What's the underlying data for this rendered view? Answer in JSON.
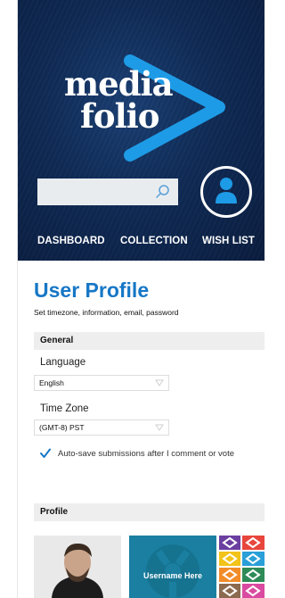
{
  "brand": {
    "line1": "media",
    "line2": "folio"
  },
  "search": {
    "placeholder": "",
    "value": ""
  },
  "nav": {
    "dashboard": "DASHBOARD",
    "collection": "COLLECTION",
    "wishlist": "WISH LIST"
  },
  "page": {
    "title": "User Profile",
    "subtitle": "Set timezone, information, email, password"
  },
  "general": {
    "heading": "General",
    "language_label": "Language",
    "language_value": "English",
    "timezone_label": "Time Zone",
    "timezone_value": "(GMT-8) PST",
    "autosave_label": "Auto-save submissions after I comment or vote",
    "autosave_checked": true
  },
  "profile": {
    "heading": "Profile",
    "username_placeholder": "Username Here"
  },
  "colors": {
    "header_bg": "#0f2a55",
    "accent": "#1677c6",
    "logo_blue": "#1e9be6",
    "card_teal": "#1a7fa0",
    "section_bg": "#eeeeee"
  },
  "icons": {
    "search": "search-icon",
    "user": "user-icon",
    "chevron": "chevron-down-icon",
    "check": "check-icon",
    "play_logo": "play-triangle-icon"
  }
}
